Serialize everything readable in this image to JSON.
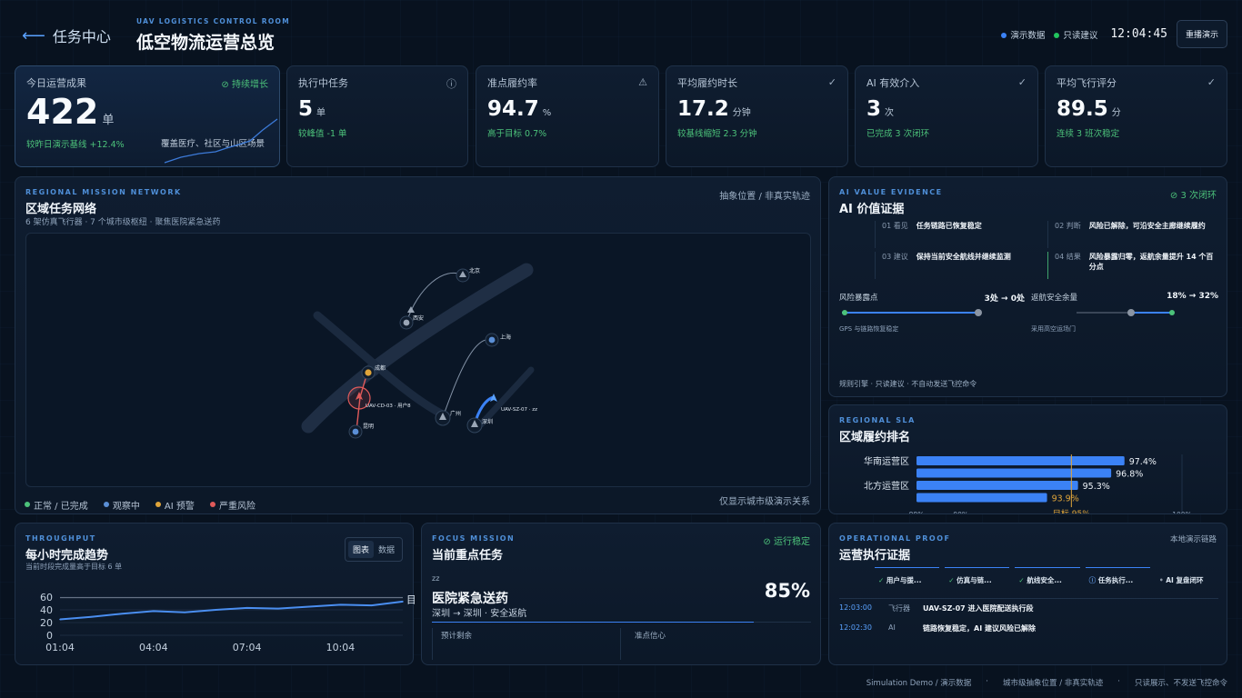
{
  "header": {
    "back_label": "任务中心",
    "eyebrow": "UAV LOGISTICS CONTROL ROOM",
    "title": "低空物流运营总览",
    "demo_data": "演示数据",
    "suggest_only": "只读建议",
    "clock": "12:04:45",
    "replay": "重播演示",
    "colors": {
      "demo": "#3b82f6",
      "suggest": "#22c55e"
    }
  },
  "kpis": [
    {
      "label": "今日运营成果",
      "value": "422",
      "unit": "单",
      "note": "较昨日演示基线 +12.4%",
      "badge": "持续增长",
      "extra": "覆盖医疗、社区与山区场景",
      "icon": "check-circle-icon"
    },
    {
      "label": "执行中任务",
      "value": "5",
      "unit": "单",
      "note": "较峰值 -1 单",
      "icon": "info-icon"
    },
    {
      "label": "准点履约率",
      "value": "94.7",
      "unit": "%",
      "note": "高于目标 0.7%",
      "icon": "warning-icon"
    },
    {
      "label": "平均履约时长",
      "value": "17.2",
      "unit": "分钟",
      "note": "较基线缩短 2.3 分钟",
      "icon": "check-circle-icon"
    },
    {
      "label": "AI 有效介入",
      "value": "3",
      "unit": "次",
      "note": "已完成 3 次闭环",
      "icon": "check-circle-icon"
    },
    {
      "label": "平均飞行评分",
      "value": "89.5",
      "unit": "分",
      "note": "连续 3 班次稳定",
      "icon": "check-circle-icon"
    }
  ],
  "network": {
    "eyebrow": "REGIONAL MISSION NETWORK",
    "title": "区域任务网络",
    "subtitle": "6 架仿真飞行器 · 7 个城市级枢纽 · 聚焦医院紧急送药",
    "tag": "抽象位置 / 非真实轨迹",
    "cities": [
      "北京",
      "西安",
      "上海",
      "成都",
      "广州",
      "深圳",
      "昆明"
    ],
    "drone_cd": "UAV-CD-03 · 用户8",
    "drone_sz": "UAV-SZ-07 · zz",
    "legend": [
      "正常 / 已完成",
      "观察中",
      "AI 预警",
      "严重风险"
    ],
    "legend_colors": [
      "#4cc27a",
      "#5b8fd6",
      "#e0a53a",
      "#e05a5a"
    ],
    "footnote": "仅显示城市级演示关系"
  },
  "ai_value": {
    "eyebrow": "AI VALUE EVIDENCE",
    "title": "AI 价值证据",
    "badge": "3 次闭环",
    "steps": [
      {
        "idx": "01 看见",
        "text": "任务链路已恢复稳定"
      },
      {
        "idx": "02 判断",
        "text": "风险已解除，可沿安全主廊继续履约"
      },
      {
        "idx": "03 建议",
        "text": "保持当前安全航线并继续监测"
      },
      {
        "idx": "04 结果",
        "text": "风险暴露归零，返航余量提升 14 个百分点"
      }
    ],
    "risk_label": "风险暴露点",
    "risk_value": "3处 → 0处",
    "risk_note": "GPS 与链路恢复稳定",
    "reserve_label": "返航安全余量",
    "reserve_value": "18% → 32%",
    "reserve_note": "采用高空运场门",
    "footnote": "规则引擎 · 只读建议 · 不自动发送飞控命令"
  },
  "sla": {
    "eyebrow": "REGIONAL SLA",
    "title": "区域履约排名",
    "rows": [
      {
        "label": "华南运营区",
        "value": 97.4,
        "text": "97.4%"
      },
      {
        "label": "",
        "value": 96.8,
        "text": "96.8%"
      },
      {
        "label": "北方运营区",
        "value": 95.3,
        "text": "95.3%"
      },
      {
        "label": "",
        "value": 93.9,
        "text": "93.9%"
      }
    ],
    "axis": [
      "88%",
      "90%",
      "100%"
    ],
    "target_label": "目标 95%",
    "target": 95
  },
  "throughput": {
    "eyebrow": "THROUGHPUT",
    "title": "每小时完成趋势",
    "subtitle": "当前时段完成量高于目标 6 单",
    "tab_chart": "图表",
    "tab_data": "数据",
    "target_label": "目"
  },
  "chart_data": {
    "type": "line",
    "x": [
      "01:04",
      "02:04",
      "03:04",
      "04:04",
      "05:04",
      "06:04",
      "07:04",
      "08:04",
      "09:04",
      "10:04",
      "11:04",
      "12:04"
    ],
    "xticks": [
      "01:04",
      "04:04",
      "07:04",
      "10:04"
    ],
    "series": [
      {
        "values": [
          25,
          29,
          34,
          38,
          36,
          40,
          43,
          42,
          45,
          48,
          47,
          53
        ]
      }
    ],
    "target": 59,
    "ylim": [
      0,
      60
    ],
    "yticks": [
      "60",
      "40",
      "20",
      "0"
    ],
    "grid": true
  },
  "focus": {
    "eyebrow": "FOCUS MISSION",
    "title": "当前重点任务",
    "badge": "运行稳定",
    "tag": "zz",
    "name": "医院紧急送药",
    "route": "深圳 → 深圳 · 安全返航",
    "progress_text": "85%",
    "progress": 0.85,
    "col1": "预计剩余",
    "col2": "准点信心"
  },
  "proof": {
    "eyebrow": "OPERATIONAL PROOF",
    "title": "运营执行证据",
    "tag": "本地演示链路",
    "steps": [
      "用户与援...",
      "仿真与链...",
      "航线安全...",
      "任务执行...",
      "AI 复盘闭环"
    ],
    "log": [
      {
        "time": "12:03:00",
        "src": "飞行器",
        "text": "UAV-SZ-07 进入医院配送执行段"
      },
      {
        "time": "12:02:30",
        "src": "AI",
        "text": "链路恢复稳定，AI 建议风险已解除"
      }
    ]
  },
  "footer": [
    "Simulation Demo / 演示数据",
    "城市级抽象位置 / 非真实轨迹",
    "只读展示、不发送飞控命令"
  ]
}
